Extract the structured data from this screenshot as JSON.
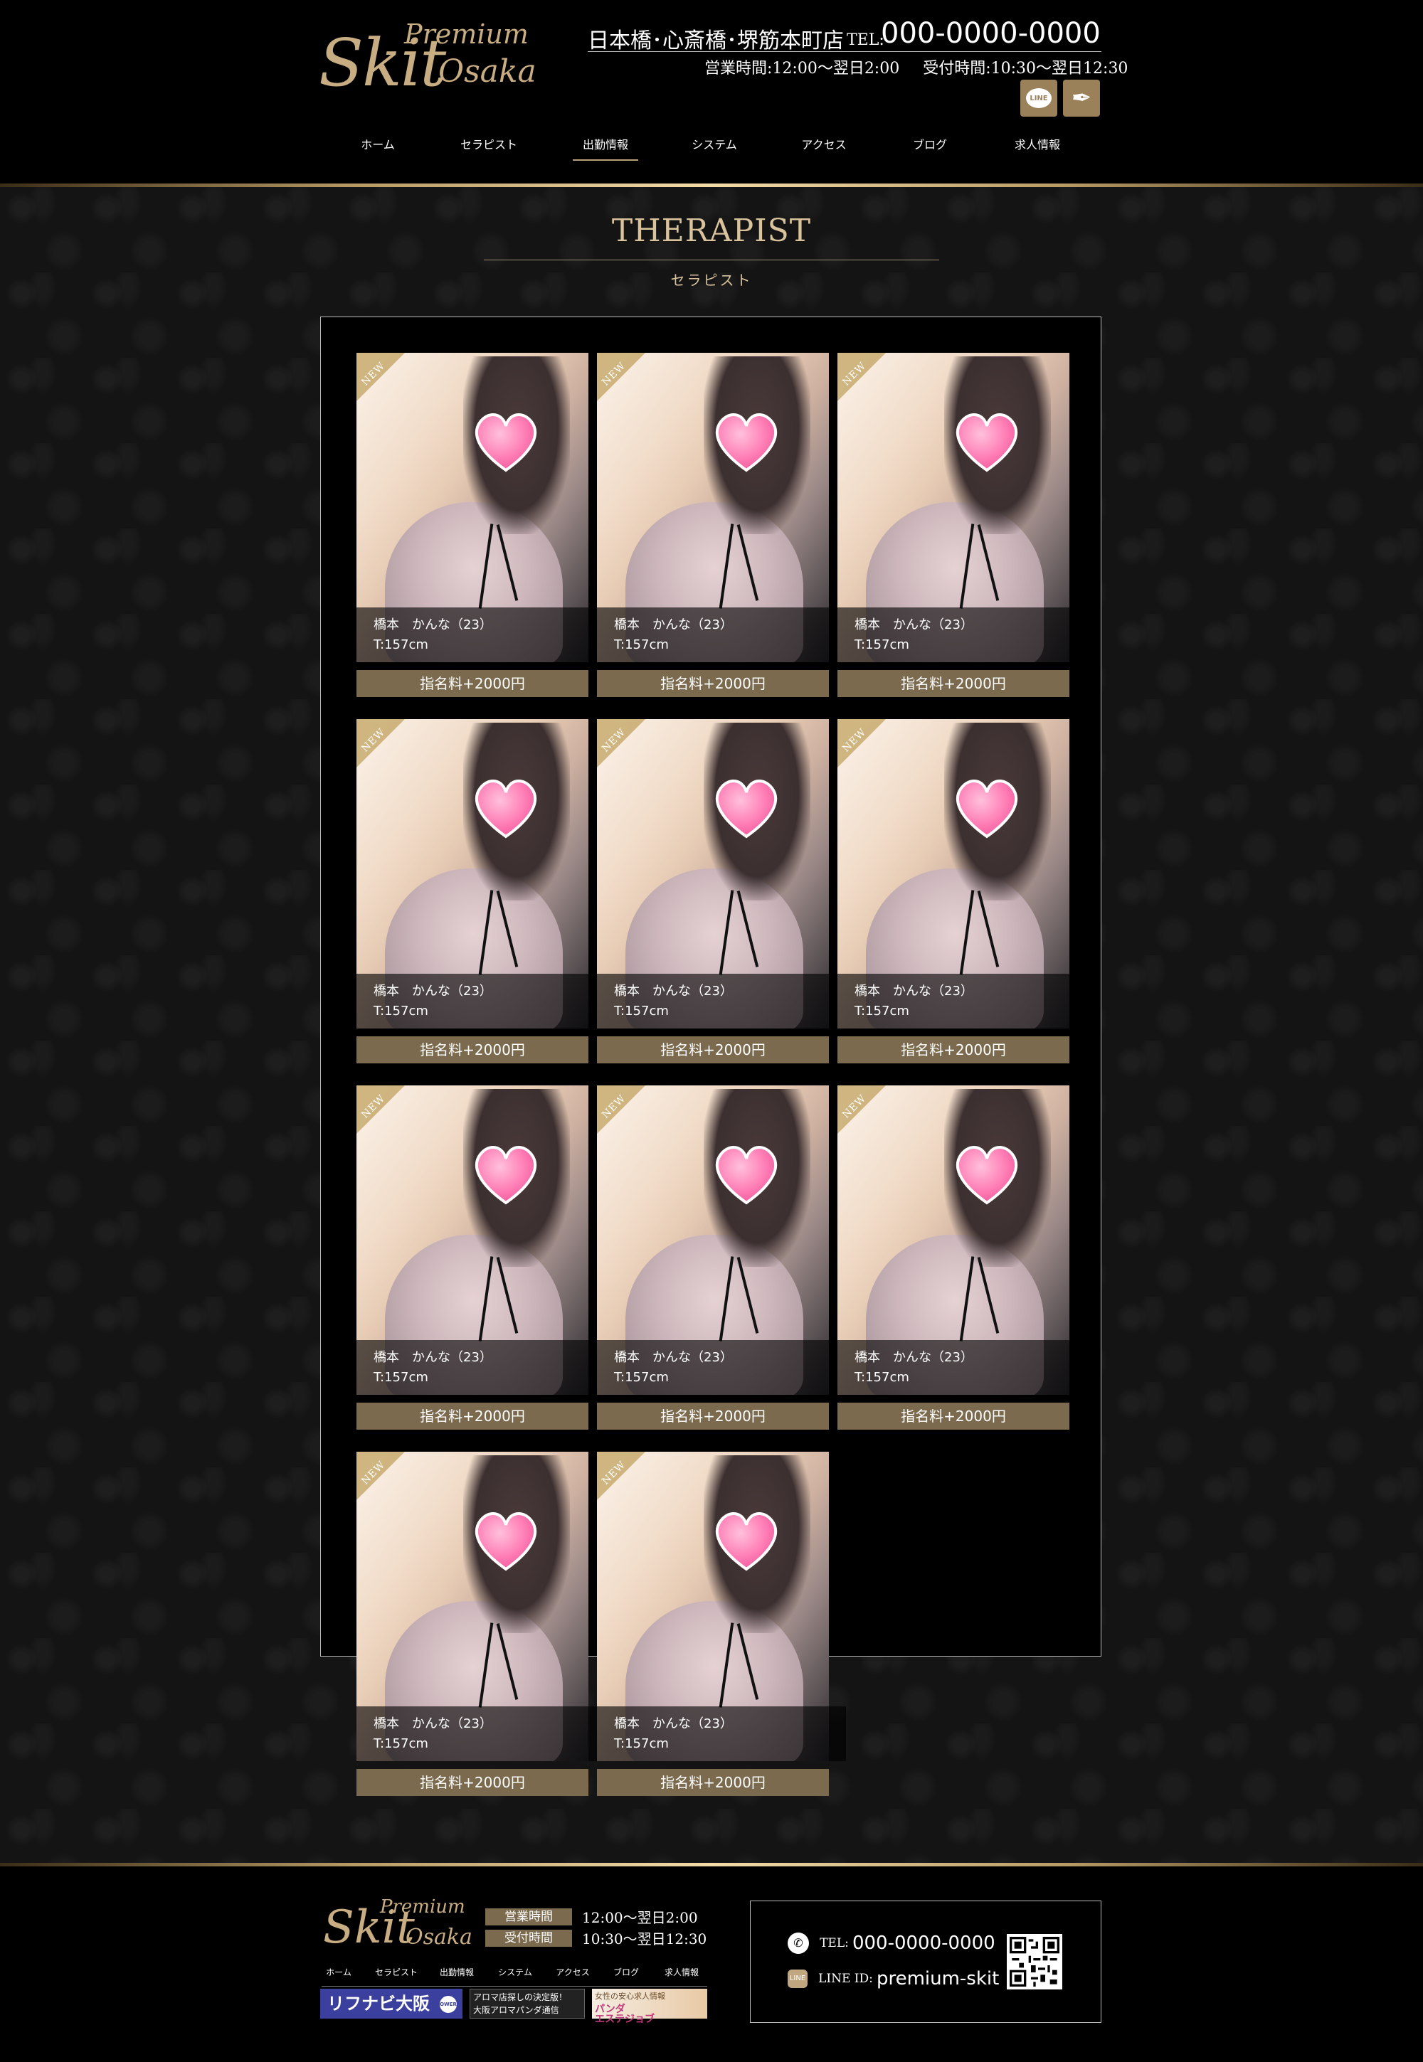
{
  "header": {
    "logo": {
      "word1": "Skit",
      "word2": "Premium",
      "word3": "Osaka"
    },
    "shop_name": "日本橋･心斎橋･堺筋本町店",
    "tel_label": "TEL:",
    "tel": "000-0000-0000",
    "business_hours": "営業時間:12:00～翌日2:00",
    "reception_hours": "受付時間:10:30～翌日12:30",
    "line_icon_text": "LINE",
    "icons": [
      "line-icon",
      "feather-icon"
    ]
  },
  "nav": [
    {
      "label": "ホーム"
    },
    {
      "label": "セラピスト"
    },
    {
      "label": "出勤情報",
      "active": true
    },
    {
      "label": "システム"
    },
    {
      "label": "アクセス"
    },
    {
      "label": "ブログ"
    },
    {
      "label": "求人情報"
    }
  ],
  "section": {
    "title_en": "THERAPIST",
    "title_ja": "セラピスト"
  },
  "therapists": [
    {
      "tag": "NEW",
      "name": "橋本　かんな（23）",
      "height": "T:157cm",
      "fee": "指名料+2000円"
    },
    {
      "tag": "NEW",
      "name": "橋本　かんな（23）",
      "height": "T:157cm",
      "fee": "指名料+2000円"
    },
    {
      "tag": "NEW",
      "name": "橋本　かんな（23）",
      "height": "T:157cm",
      "fee": "指名料+2000円"
    },
    {
      "tag": "NEW",
      "name": "橋本　かんな（23）",
      "height": "T:157cm",
      "fee": "指名料+2000円"
    },
    {
      "tag": "NEW",
      "name": "橋本　かんな（23）",
      "height": "T:157cm",
      "fee": "指名料+2000円"
    },
    {
      "tag": "NEW",
      "name": "橋本　かんな（23）",
      "height": "T:157cm",
      "fee": "指名料+2000円"
    },
    {
      "tag": "NEW",
      "name": "橋本　かんな（23）",
      "height": "T:157cm",
      "fee": "指名料+2000円"
    },
    {
      "tag": "NEW",
      "name": "橋本　かんな（23）",
      "height": "T:157cm",
      "fee": "指名料+2000円"
    },
    {
      "tag": "NEW",
      "name": "橋本　かんな（23）",
      "height": "T:157cm",
      "fee": "指名料+2000円"
    },
    {
      "tag": "NEW",
      "name": "橋本　かんな（23）",
      "height": "T:157cm",
      "fee": "指名料+2000円"
    },
    {
      "tag": "NEW",
      "name": "橋本　かんな（23）",
      "height": "T:157cm",
      "fee": "指名料+2000円"
    }
  ],
  "footer": {
    "business_hours_label": "営業時間",
    "business_hours": "12:00～翌日2:00",
    "reception_label": "受付時間",
    "reception_hours": "10:30～翌日12:30",
    "nav": [
      "ホーム",
      "セラピスト",
      "出勤情報",
      "システム",
      "アクセス",
      "ブログ",
      "求人情報"
    ],
    "banners": {
      "b1": "リフナビ大阪",
      "b1_badge": "OWER",
      "b2_line1": "アロマ店探しの決定版！",
      "b2_line2": "大阪アロマパンダ通信",
      "b3_line1": "女性の安心求人情報",
      "b3_line2": "パンダ",
      "b3_line3": "エステジョブ"
    },
    "tel_label": "TEL:",
    "tel": "000-0000-0000",
    "line_label": "LINE ID:",
    "line_id": "premium-skit",
    "line_icon_text": "LINE"
  },
  "colors": {
    "gold": "#c9ad82",
    "button": "#7b6a4d",
    "accent": "#d8c39d"
  }
}
